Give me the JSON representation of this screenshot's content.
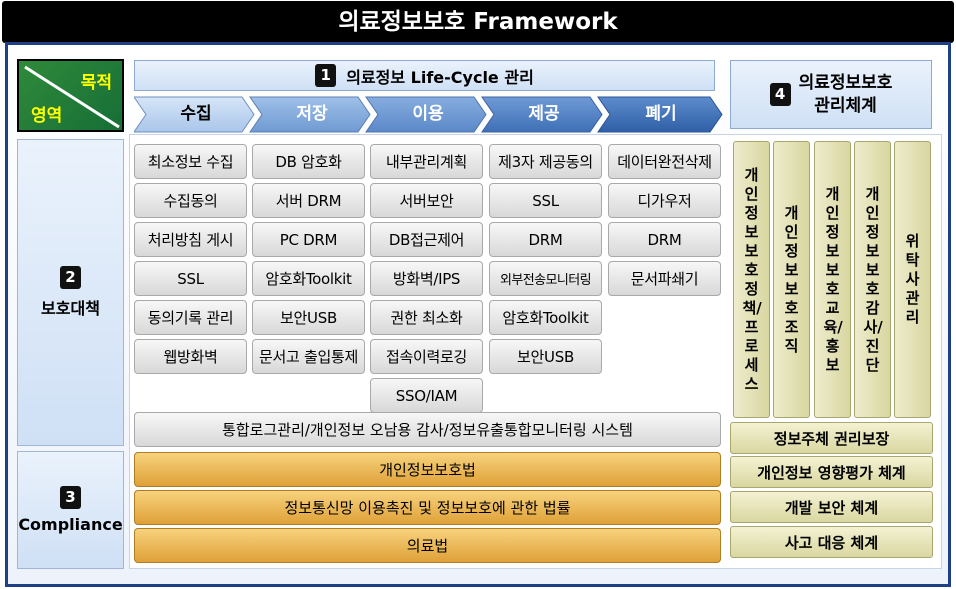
{
  "title": "의료정보보호 Framework",
  "corner": {
    "purpose": "목적",
    "area": "영역"
  },
  "lifecycle": {
    "number": "1",
    "title": "의료정보 Life-Cycle 관리",
    "stages": [
      "수집",
      "저장",
      "이용",
      "제공",
      "폐기"
    ]
  },
  "management": {
    "number": "4",
    "title_line1": "의료정보보호",
    "title_line2": "관리체계"
  },
  "protection": {
    "number": "2",
    "label": "보호대책",
    "columns": [
      [
        "최소정보 수집",
        "수집동의",
        "처리방침 게시",
        "SSL",
        "동의기록 관리",
        "웹방화벽"
      ],
      [
        "DB 암호화",
        "서버 DRM",
        "PC DRM",
        "암호화Toolkit",
        "보안USB",
        "문서고 출입통제"
      ],
      [
        "내부관리계획",
        "서버보안",
        "DB접근제어",
        "방화벽/IPS",
        "권한 최소화",
        "접속이력로깅",
        "SSO/IAM"
      ],
      [
        "제3자 제공동의",
        "SSL",
        "DRM",
        "외부전송모니터링",
        "암호화Toolkit",
        "보안USB"
      ],
      [
        "데이터완전삭제",
        "디가우저",
        "DRM",
        "문서파쇄기"
      ]
    ],
    "integrated_system": "통합로그관리/개인정보 오남용 감사/정보유출통합모니터링 시스템"
  },
  "compliance": {
    "number": "3",
    "label": "Compliance",
    "laws": [
      "개인정보보호법",
      "정보통신망 이용촉진 및 정보보호에 관한 법률",
      "의료법"
    ]
  },
  "management_items": {
    "vertical": [
      "개인정보보호정책/프로세스",
      "개인정보보호조직",
      "개인정보보호교육/홍보",
      "개인정보보호감사/진단",
      "위탁사관리"
    ],
    "horizontal": [
      "정보주체 권리보장",
      "개인정보 영향평가 체계",
      "개발 보안 체계",
      "사고 대응 체계"
    ]
  },
  "colors": {
    "title_bg": "#000000",
    "frame_border": "#1f3f86",
    "corner_green": "#1f7d38",
    "corner_text": "#ffff00",
    "chevron_light": "#bcd3ef",
    "chevron_dark": "#3c6eb4",
    "law_orange": "#e8b24f",
    "mgmt_khaki": "#e0dfb2"
  }
}
